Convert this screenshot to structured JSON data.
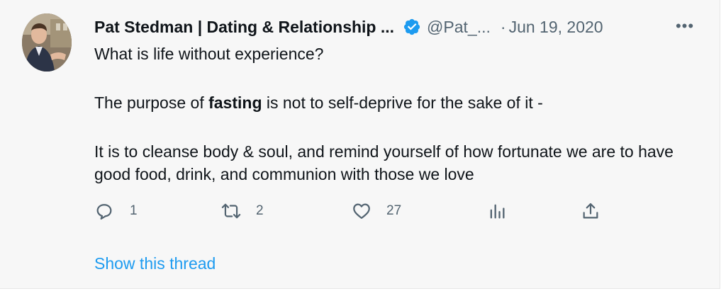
{
  "tweet": {
    "author": {
      "display_name": "Pat Stedman | Dating & Relationship ...",
      "handle": "@Pat_...",
      "verified": true,
      "avatar_icon": "profile-photo"
    },
    "separator": "·",
    "date": "Jun 19, 2020",
    "more_icon": "•••",
    "body": {
      "line1": "What is life without experience?",
      "line2_prefix": "The purpose of ",
      "line2_bold": "fasting",
      "line2_suffix": " is not to self-deprive for the sake of it -",
      "line3": "It is to cleanse body & soul, and remind yourself of how fortunate we are to have good food, drink, and communion with those we love"
    },
    "actions": {
      "reply_count": "1",
      "retweet_count": "2",
      "like_count": "27"
    },
    "show_thread": "Show this thread"
  },
  "colors": {
    "background": "#f7f7f7",
    "text": "#0f1419",
    "muted": "#536471",
    "accent": "#1d9bf0"
  }
}
